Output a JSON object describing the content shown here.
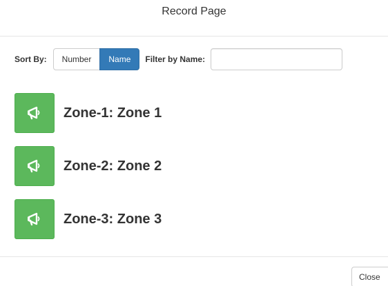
{
  "modal": {
    "title": "Record Page"
  },
  "toolbar": {
    "sort_label": "Sort By:",
    "sort_options": [
      {
        "label": "Number",
        "active": false
      },
      {
        "label": "Name",
        "active": true
      }
    ],
    "filter_label": "Filter by Name:",
    "filter_value": "",
    "filter_placeholder": ""
  },
  "zones": [
    {
      "label": "Zone-1: Zone 1",
      "icon": "megaphone-icon"
    },
    {
      "label": "Zone-2: Zone 2",
      "icon": "megaphone-icon"
    },
    {
      "label": "Zone-3: Zone 3",
      "icon": "megaphone-icon"
    }
  ],
  "footer": {
    "close_label": "Close"
  },
  "colors": {
    "primary": "#337ab7",
    "success": "#5cb85c",
    "text": "#333333"
  }
}
